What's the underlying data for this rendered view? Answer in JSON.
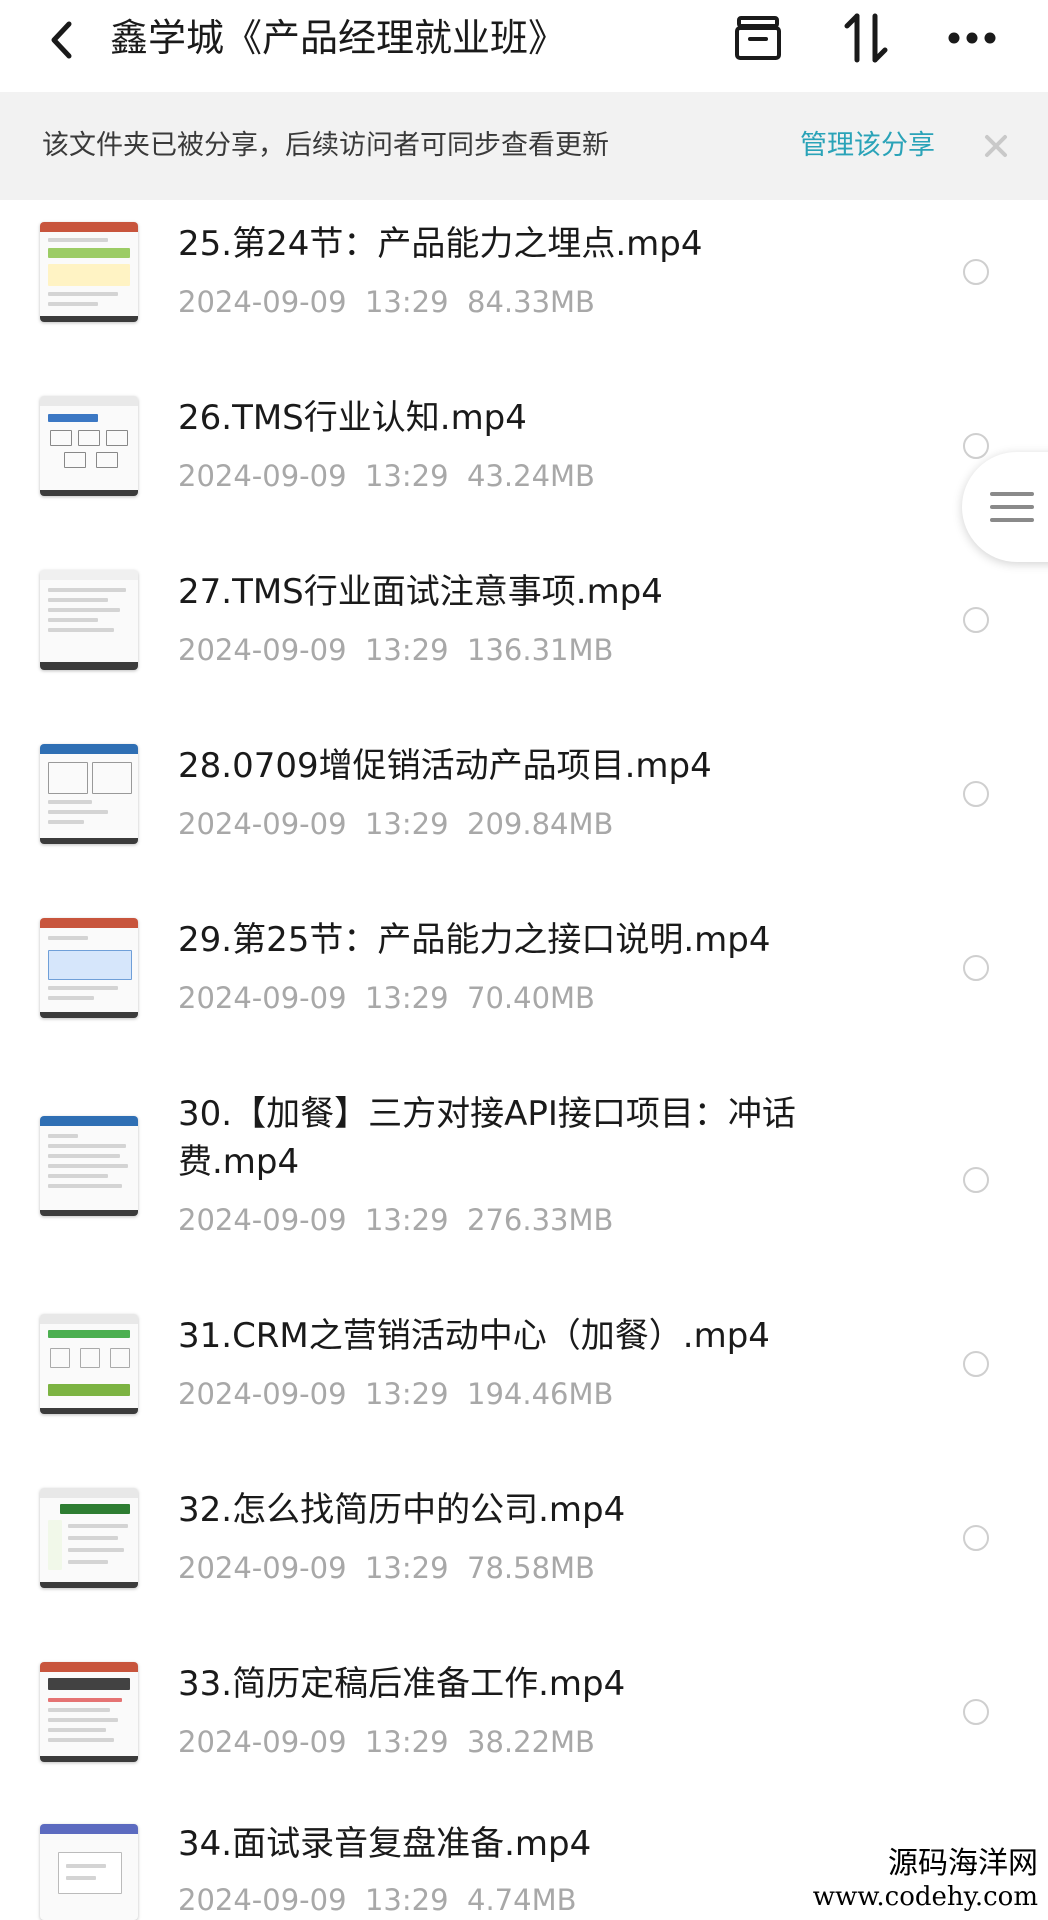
{
  "header": {
    "title": "鑫学城《产品经理就业班》",
    "back_icon": "chevron-left-icon",
    "actions": [
      {
        "name": "archive-icon"
      },
      {
        "name": "sort-icon"
      },
      {
        "name": "more-icon"
      }
    ]
  },
  "share_banner": {
    "text": "该文件夹已被分享，后续访问者可同步查看更新",
    "link_label": "管理该分享",
    "close_icon": "close-icon",
    "link_color": "#2aa3b8"
  },
  "files": [
    {
      "name": "25.第24节：产品能力之埋点.mp4",
      "date": "2024-09-09",
      "time": "13:29",
      "size": "84.33MB"
    },
    {
      "name": "26.TMS行业认知.mp4",
      "date": "2024-09-09",
      "time": "13:29",
      "size": "43.24MB"
    },
    {
      "name": "27.TMS行业面试注意事项.mp4",
      "date": "2024-09-09",
      "time": "13:29",
      "size": "136.31MB"
    },
    {
      "name": "28.0709增促销活动产品项目.mp4",
      "date": "2024-09-09",
      "time": "13:29",
      "size": "209.84MB"
    },
    {
      "name": "29.第25节：产品能力之接口说明.mp4",
      "date": "2024-09-09",
      "time": "13:29",
      "size": "70.40MB"
    },
    {
      "name": "30.【加餐】三方对接API接口项目：冲话费.mp4",
      "date": "2024-09-09",
      "time": "13:29",
      "size": "276.33MB"
    },
    {
      "name": "31.CRM之营销活动中心（加餐）.mp4",
      "date": "2024-09-09",
      "time": "13:29",
      "size": "194.46MB"
    },
    {
      "name": "32.怎么找简历中的公司.mp4",
      "date": "2024-09-09",
      "time": "13:29",
      "size": "78.58MB"
    },
    {
      "name": "33.简历定稿后准备工作.mp4",
      "date": "2024-09-09",
      "time": "13:29",
      "size": "38.22MB"
    },
    {
      "name": "34.面试录音复盘准备.mp4",
      "date": "2024-09-09",
      "time": "13:29",
      "size": "4.74MB"
    }
  ],
  "side_handle": {
    "icon": "menu-lines-icon"
  },
  "watermark": {
    "text_cn": "源码海洋网",
    "url": "www.codehy.com"
  }
}
